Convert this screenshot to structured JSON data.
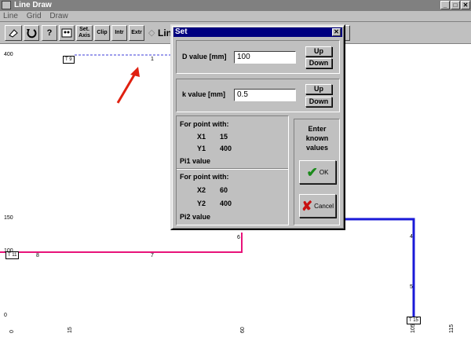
{
  "window": {
    "title": "Line Draw",
    "controls": [
      "_",
      "□",
      "✕"
    ]
  },
  "menu": [
    "Line",
    "Grid",
    "Draw"
  ],
  "toolbar": {
    "buttons": [
      "eraser",
      "undo",
      "?",
      "mask",
      "Set. Axis",
      "Clip",
      "Intr",
      "Extr"
    ],
    "label": "Lin"
  },
  "canvas": {
    "y_labels": [
      "400",
      "150",
      "100",
      "0"
    ],
    "x_labels": [
      "0",
      "15",
      "60",
      "105",
      "115"
    ],
    "tags": [
      "T 9",
      "T 11",
      "T 15"
    ],
    "point_labels": [
      "1",
      "8",
      "7",
      "6",
      "4",
      "5"
    ],
    "colors": {
      "dashed": "#3b3bd8",
      "pink": "#e8137a",
      "blue": "#1a1ad8",
      "arrow": "#e02010"
    }
  },
  "dialog": {
    "title": "Set",
    "close": "✕",
    "d_label": "D value [mm]",
    "d_value": "100",
    "k_label": "k value [mm]",
    "k_value": "0.5",
    "up": "Up",
    "down": "Down",
    "point1_header": "For point with:",
    "x1_label": "X1",
    "x1_value": "15",
    "y1_label": "Y1",
    "y1_value": "400",
    "pi1_label": "Pi1 value",
    "point2_header": "For point with:",
    "x2_label": "X2",
    "x2_value": "60",
    "y2_label": "Y2",
    "y2_value": "400",
    "pi2_label": "Pi2 value",
    "prompt": "Enter known values",
    "ok_label": "OK",
    "cancel_label": "Cancel"
  }
}
